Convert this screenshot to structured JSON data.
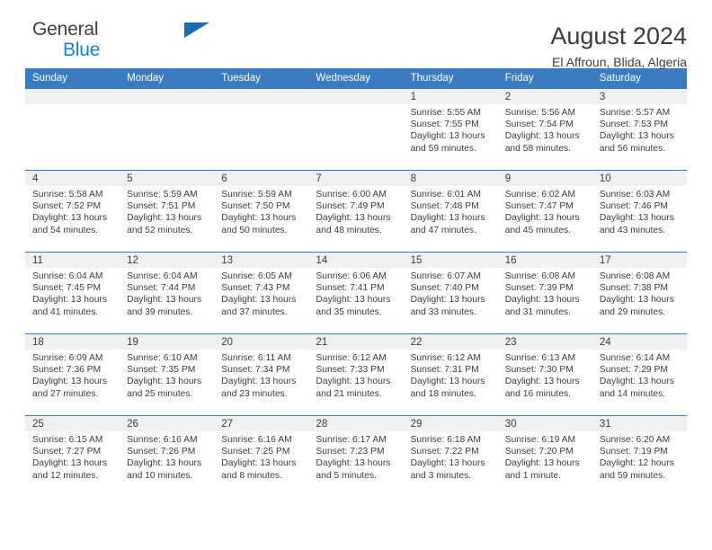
{
  "brand": {
    "name_line1": "General",
    "name_line2": "Blue",
    "accent_color": "#1a7ed6",
    "triangle_color": "#1a6cb5"
  },
  "header": {
    "title": "August 2024",
    "subtitle": "El Affroun, Blida, Algeria"
  },
  "calendar": {
    "header_bg": "#3b7cc0",
    "daynum_bg": "#f0f0f0",
    "weekday_headers": [
      "Sunday",
      "Monday",
      "Tuesday",
      "Wednesday",
      "Thursday",
      "Friday",
      "Saturday"
    ],
    "weeks": [
      [
        {
          "day": "",
          "lines": []
        },
        {
          "day": "",
          "lines": []
        },
        {
          "day": "",
          "lines": []
        },
        {
          "day": "",
          "lines": []
        },
        {
          "day": "1",
          "lines": [
            "Sunrise: 5:55 AM",
            "Sunset: 7:55 PM",
            "Daylight: 13 hours",
            "and 59 minutes."
          ]
        },
        {
          "day": "2",
          "lines": [
            "Sunrise: 5:56 AM",
            "Sunset: 7:54 PM",
            "Daylight: 13 hours",
            "and 58 minutes."
          ]
        },
        {
          "day": "3",
          "lines": [
            "Sunrise: 5:57 AM",
            "Sunset: 7:53 PM",
            "Daylight: 13 hours",
            "and 56 minutes."
          ]
        }
      ],
      [
        {
          "day": "4",
          "lines": [
            "Sunrise: 5:58 AM",
            "Sunset: 7:52 PM",
            "Daylight: 13 hours",
            "and 54 minutes."
          ]
        },
        {
          "day": "5",
          "lines": [
            "Sunrise: 5:59 AM",
            "Sunset: 7:51 PM",
            "Daylight: 13 hours",
            "and 52 minutes."
          ]
        },
        {
          "day": "6",
          "lines": [
            "Sunrise: 5:59 AM",
            "Sunset: 7:50 PM",
            "Daylight: 13 hours",
            "and 50 minutes."
          ]
        },
        {
          "day": "7",
          "lines": [
            "Sunrise: 6:00 AM",
            "Sunset: 7:49 PM",
            "Daylight: 13 hours",
            "and 48 minutes."
          ]
        },
        {
          "day": "8",
          "lines": [
            "Sunrise: 6:01 AM",
            "Sunset: 7:48 PM",
            "Daylight: 13 hours",
            "and 47 minutes."
          ]
        },
        {
          "day": "9",
          "lines": [
            "Sunrise: 6:02 AM",
            "Sunset: 7:47 PM",
            "Daylight: 13 hours",
            "and 45 minutes."
          ]
        },
        {
          "day": "10",
          "lines": [
            "Sunrise: 6:03 AM",
            "Sunset: 7:46 PM",
            "Daylight: 13 hours",
            "and 43 minutes."
          ]
        }
      ],
      [
        {
          "day": "11",
          "lines": [
            "Sunrise: 6:04 AM",
            "Sunset: 7:45 PM",
            "Daylight: 13 hours",
            "and 41 minutes."
          ]
        },
        {
          "day": "12",
          "lines": [
            "Sunrise: 6:04 AM",
            "Sunset: 7:44 PM",
            "Daylight: 13 hours",
            "and 39 minutes."
          ]
        },
        {
          "day": "13",
          "lines": [
            "Sunrise: 6:05 AM",
            "Sunset: 7:43 PM",
            "Daylight: 13 hours",
            "and 37 minutes."
          ]
        },
        {
          "day": "14",
          "lines": [
            "Sunrise: 6:06 AM",
            "Sunset: 7:41 PM",
            "Daylight: 13 hours",
            "and 35 minutes."
          ]
        },
        {
          "day": "15",
          "lines": [
            "Sunrise: 6:07 AM",
            "Sunset: 7:40 PM",
            "Daylight: 13 hours",
            "and 33 minutes."
          ]
        },
        {
          "day": "16",
          "lines": [
            "Sunrise: 6:08 AM",
            "Sunset: 7:39 PM",
            "Daylight: 13 hours",
            "and 31 minutes."
          ]
        },
        {
          "day": "17",
          "lines": [
            "Sunrise: 6:08 AM",
            "Sunset: 7:38 PM",
            "Daylight: 13 hours",
            "and 29 minutes."
          ]
        }
      ],
      [
        {
          "day": "18",
          "lines": [
            "Sunrise: 6:09 AM",
            "Sunset: 7:36 PM",
            "Daylight: 13 hours",
            "and 27 minutes."
          ]
        },
        {
          "day": "19",
          "lines": [
            "Sunrise: 6:10 AM",
            "Sunset: 7:35 PM",
            "Daylight: 13 hours",
            "and 25 minutes."
          ]
        },
        {
          "day": "20",
          "lines": [
            "Sunrise: 6:11 AM",
            "Sunset: 7:34 PM",
            "Daylight: 13 hours",
            "and 23 minutes."
          ]
        },
        {
          "day": "21",
          "lines": [
            "Sunrise: 6:12 AM",
            "Sunset: 7:33 PM",
            "Daylight: 13 hours",
            "and 21 minutes."
          ]
        },
        {
          "day": "22",
          "lines": [
            "Sunrise: 6:12 AM",
            "Sunset: 7:31 PM",
            "Daylight: 13 hours",
            "and 18 minutes."
          ]
        },
        {
          "day": "23",
          "lines": [
            "Sunrise: 6:13 AM",
            "Sunset: 7:30 PM",
            "Daylight: 13 hours",
            "and 16 minutes."
          ]
        },
        {
          "day": "24",
          "lines": [
            "Sunrise: 6:14 AM",
            "Sunset: 7:29 PM",
            "Daylight: 13 hours",
            "and 14 minutes."
          ]
        }
      ],
      [
        {
          "day": "25",
          "lines": [
            "Sunrise: 6:15 AM",
            "Sunset: 7:27 PM",
            "Daylight: 13 hours",
            "and 12 minutes."
          ]
        },
        {
          "day": "26",
          "lines": [
            "Sunrise: 6:16 AM",
            "Sunset: 7:26 PM",
            "Daylight: 13 hours",
            "and 10 minutes."
          ]
        },
        {
          "day": "27",
          "lines": [
            "Sunrise: 6:16 AM",
            "Sunset: 7:25 PM",
            "Daylight: 13 hours",
            "and 8 minutes."
          ]
        },
        {
          "day": "28",
          "lines": [
            "Sunrise: 6:17 AM",
            "Sunset: 7:23 PM",
            "Daylight: 13 hours",
            "and 5 minutes."
          ]
        },
        {
          "day": "29",
          "lines": [
            "Sunrise: 6:18 AM",
            "Sunset: 7:22 PM",
            "Daylight: 13 hours",
            "and 3 minutes."
          ]
        },
        {
          "day": "30",
          "lines": [
            "Sunrise: 6:19 AM",
            "Sunset: 7:20 PM",
            "Daylight: 13 hours",
            "and 1 minute."
          ]
        },
        {
          "day": "31",
          "lines": [
            "Sunrise: 6:20 AM",
            "Sunset: 7:19 PM",
            "Daylight: 12 hours",
            "and 59 minutes."
          ]
        }
      ]
    ]
  }
}
